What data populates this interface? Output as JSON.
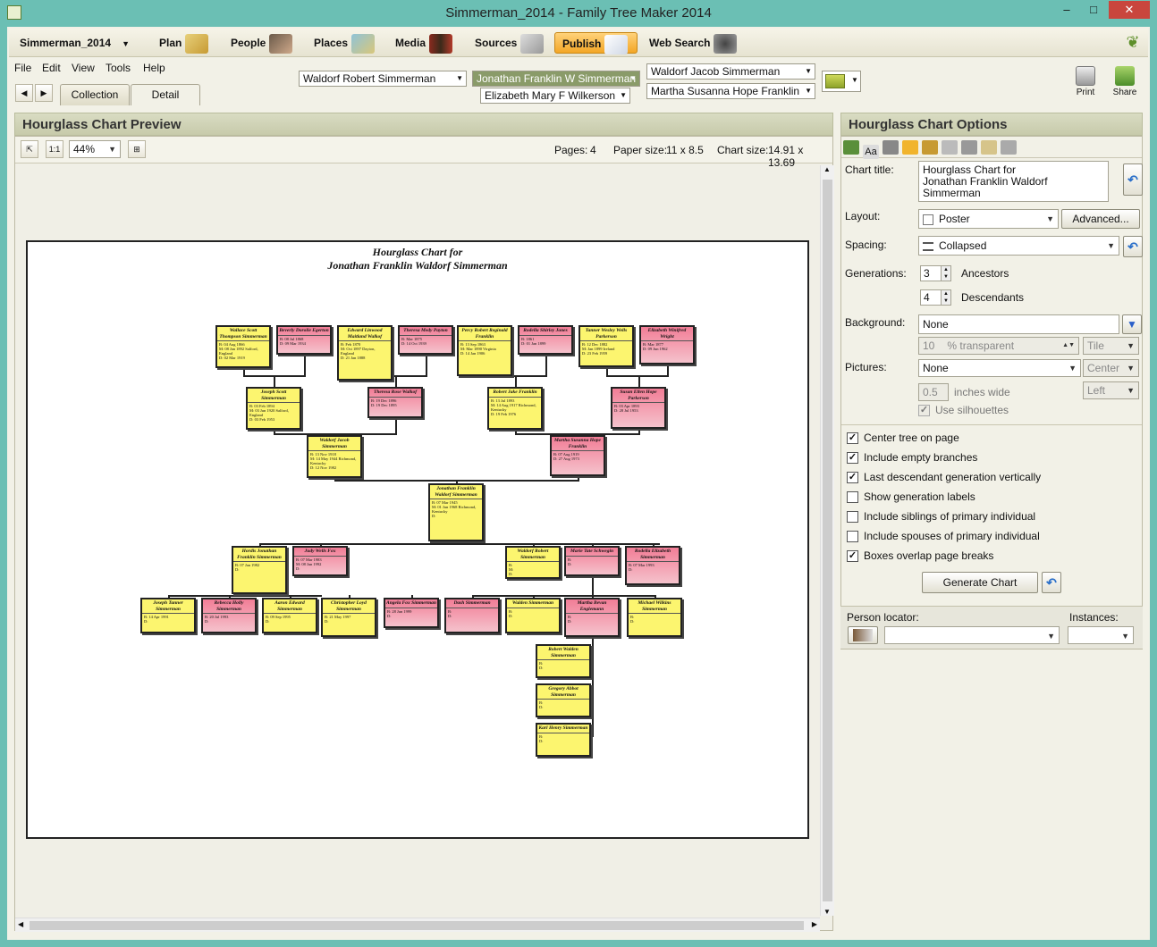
{
  "window": {
    "title": "Simmerman_2014 - Family Tree Maker 2014",
    "minimize": "–",
    "maximize": "□",
    "close": "✕"
  },
  "nav": {
    "file": "Simmerman_2014",
    "items": [
      "Plan",
      "People",
      "Places",
      "Media",
      "Sources",
      "Publish",
      "Web Search"
    ]
  },
  "menu": [
    "File",
    "Edit",
    "View",
    "Tools",
    "Help"
  ],
  "tabs": {
    "collection": "Collection",
    "detail": "Detail"
  },
  "family": {
    "father": "Waldorf Robert Simmerman",
    "mother": "Elizabeth Mary F Wilkerson",
    "selected": "Jonathan Franklin W Simmerman",
    "spouse_father": "Waldorf Jacob Simmerman",
    "spouse_mother": "Martha Susanna Hope Franklin"
  },
  "ribbon": {
    "print": "Print",
    "share": "Share"
  },
  "preview": {
    "header": "Hourglass Chart Preview",
    "zoom": "44%",
    "pages_label": "Pages:",
    "pages": "4",
    "paper_label": "Paper size:",
    "paper": "11 x 8.5",
    "chart_label": "Chart size:",
    "chart": "14.91 x 13.69"
  },
  "chart": {
    "title1": "Hourglass Chart for",
    "title2": "Jonathan Franklin Waldorf Simmerman",
    "boxes": [
      {
        "n": "Wallace Scott Thompson Simmerman",
        "d": "B: 04 Aug 1866\nM: 08 Jan 1892 Salford, England\nD: 02 Mar 1919"
      },
      {
        "n": "Beverly Dorolie Egerton",
        "d": "B: 08 Jul 1868\nD: 09 Mar 1934"
      },
      {
        "n": "Edward Linwood Maitland Walkof",
        "d": "B: Feb 1870\nM: Oct 1897 Dayton, England\nD: 21 Jan 1888"
      },
      {
        "n": "Theresa Medy Payton",
        "d": "B: Mar 1875\nD: 14 Oct 1939"
      },
      {
        "n": "Percy Robert Reginald Franklin",
        "d": "B: 13 Sep 1863\nM: Mar 1890 Virginia\nD: 14 Jan 1906"
      },
      {
        "n": "Rodella Shirley Jones",
        "d": "B: 1861\nD: 01 Jan 1899"
      },
      {
        "n": "Tanner Wesley Wells Parkerson",
        "d": "B: 12 Dec 1882\nM: Jan 1899 Ireland\nD: 23 Feb 1959"
      },
      {
        "n": "Elizabeth Winifred Wright",
        "d": "B: Mar 1877\nD: 09 Jun 1962"
      },
      {
        "n": "Joseph Scott Simmerman",
        "d": "B: 03 Feb 1894\nM: 03 Jun 1920 Salford, England\nD: 03 Feb 1953"
      },
      {
        "n": "Theresa Rose Walkof",
        "d": "B: 19 Dec 1896\nD: 19 Dec 1895"
      },
      {
        "n": "Robert Jake Franklin",
        "d": "B: 13 Jul 1893\nM: 14 Aug 1917 Richmond, Kentucky\nD: 19 Feb 1976"
      },
      {
        "n": "Susan Ellen Hope Parkerson",
        "d": "B: 03 Apr 1893\nD: 28 Jul 1953"
      },
      {
        "n": "Waldorf Jacob Simmerman",
        "d": "B: 13 Nov 1918\nM: 14 May 1944 Richmond, Kentucky\nD: 12 Nov 1982"
      },
      {
        "n": "Martha Susanna Hope Franklin",
        "d": "B: 07 Aug 1919\nD: 27 Aug 1973"
      },
      {
        "n": "Jonathan Franklin Waldorf Simmerman",
        "d": "B: 07 Mar 1945\nM: 01 Jun 1968 Richmond, Kentucky\nD:"
      },
      {
        "n": "Hordis Jonathan Franklin Simmerman",
        "d": "B: 07 Jan 1982\nD:"
      },
      {
        "n": "Judy Wells Fox",
        "d": "B: 07 Mar 1983\nM: 08 Jun 1992\nD:"
      },
      {
        "n": "Waldorf Robert Simmerman",
        "d": "B:\nM:\nD:"
      },
      {
        "n": "Marie Tate Schwegin",
        "d": "B:\nD:"
      },
      {
        "n": "Rodella Elizabeth Simmerman",
        "d": "B: 07 Mar 1993\nD:"
      },
      {
        "n": "Joseph Tanner Simmerman",
        "d": "B: 14 Apr 1991\nD:"
      },
      {
        "n": "Rebecca Holly Simmerman",
        "d": "B: 20 Jul 1993\nD:"
      },
      {
        "n": "Aaron Edward Simmerman",
        "d": "B: 09 Sep 1995\nD:"
      },
      {
        "n": "Christopher Loyd Simmerman",
        "d": "B: 21 May 1997\nD:"
      },
      {
        "n": "Angela Fox Simmerman",
        "d": "B: 28 Jun 1999\nD:"
      },
      {
        "n": "Dash Simmerman",
        "d": "B:\nD:"
      },
      {
        "n": "Walden Simmerman",
        "d": "B:\nD:"
      },
      {
        "n": "Martha Bevan Englemann",
        "d": "B:\nD:"
      },
      {
        "n": "Michael Wilkins Simmerman",
        "d": "B:\nD:"
      },
      {
        "n": "Robert Walden Simmerman",
        "d": "B:\nD:"
      },
      {
        "n": "Gregory Abbot Simmerman",
        "d": "B:\nD:"
      },
      {
        "n": "Karl Henry Simmerman",
        "d": "B:\nD:"
      }
    ]
  },
  "options": {
    "header": "Hourglass Chart Options",
    "chart_title_label": "Chart title:",
    "chart_title_1": "Hourglass Chart for",
    "chart_title_2": "Jonathan Franklin Waldorf Simmerman",
    "layout_label": "Layout:",
    "layout": "Poster",
    "advanced": "Advanced...",
    "spacing_label": "Spacing:",
    "spacing": "Collapsed",
    "generations_label": "Generations:",
    "ancestors": "3",
    "ancestors_label": "Ancestors",
    "descendants": "4",
    "descendants_label": "Descendants",
    "background_label": "Background:",
    "background": "None",
    "transparent_value": "10",
    "transparent_label": "% transparent",
    "tile": "Tile",
    "pictures_label": "Pictures:",
    "pictures": "None",
    "center": "Center",
    "inches_value": "0.5",
    "inches_label": "inches wide",
    "left": "Left",
    "use_silhouettes": "Use silhouettes",
    "checks": [
      "Center tree on page",
      "Include empty branches",
      "Last descendant generation vertically",
      "Show generation labels",
      "Include siblings of primary individual",
      "Include spouses of primary individual",
      "Boxes overlap page breaks"
    ],
    "checked": [
      true,
      true,
      true,
      false,
      false,
      false,
      true
    ],
    "generate": "Generate Chart",
    "locator_label": "Person locator:",
    "instances_label": "Instances:"
  },
  "colors": {
    "male_box": "#fcf56f",
    "female_box": "#f27d96",
    "publish": "#f3a626",
    "frame": "#6bbfb4"
  }
}
